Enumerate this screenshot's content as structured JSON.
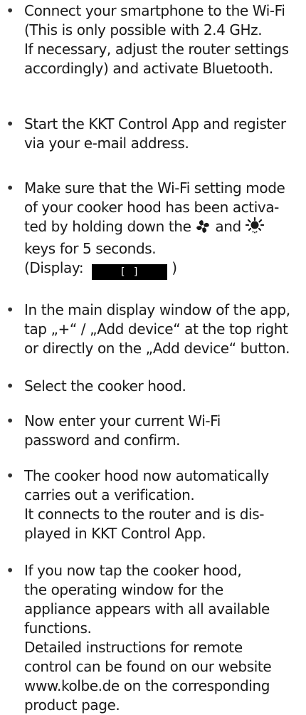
{
  "bullet_char": "•",
  "steps": [
    {
      "lines": [
        "Connect your smartphone to the Wi-Fi",
        "(This is only possible with 2.4 GHz.",
        "If necessary, adjust the router settings",
        "accordingly) and activate Bluetooth."
      ]
    },
    {
      "lines": [
        "Start the KKT Control App and register",
        "via your e-mail address."
      ]
    },
    {
      "line1": "Make sure that the  Wi-Fi setting mode",
      "line2": "of your cooker hood has been activa-",
      "line3_before": "ted by holding down the ",
      "line3_mid": " and ",
      "line4": "keys for 5 seconds.",
      "display_label": "(Display:",
      "display_value": "[ ]",
      "display_close": ")",
      "icons": [
        "fan-icon",
        "light-icon"
      ]
    },
    {
      "lines": [
        "In the main display window of the app,",
        "tap „+“ / „Add device“ at the top right",
        "or directly on the „Add device“ button."
      ]
    },
    {
      "lines": [
        "Select the cooker hood."
      ]
    },
    {
      "lines": [
        "Now enter your current Wi-Fi",
        "password and confirm."
      ]
    },
    {
      "lines": [
        "The cooker hood now automatically",
        "carries out a verification.",
        "It connects to the router and is dis-",
        "played in KKT Control App."
      ]
    },
    {
      "lines": [
        "If you now tap the cooker hood,",
        "the operating window for the",
        "appliance appears with all available",
        "functions.",
        "Detailed instructions for remote",
        "control can be found on our website",
        "www.kolbe.de on the corresponding",
        "product page."
      ]
    }
  ]
}
